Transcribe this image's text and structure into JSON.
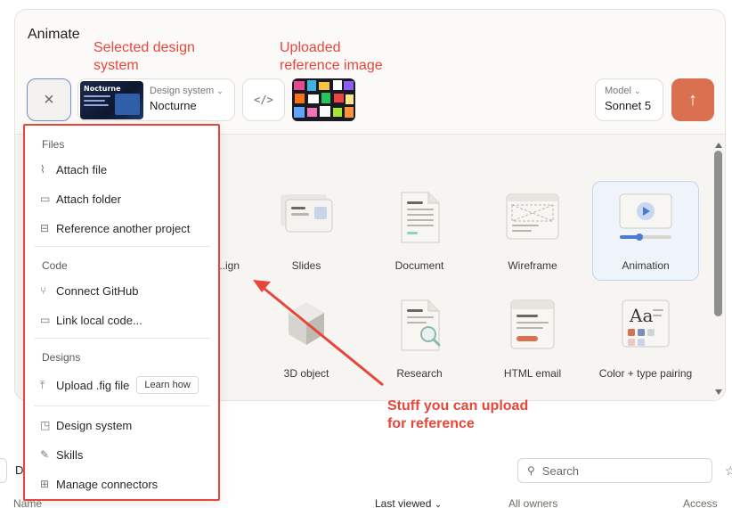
{
  "app": {
    "title": "Animate"
  },
  "toolbar": {
    "close_glyph": "×",
    "design_system": {
      "label": "Design system",
      "value": "Nocturne",
      "thumb_text": "Nocturne"
    },
    "code_glyph": "</>",
    "model": {
      "label": "Model",
      "value": "Sonnet 5"
    },
    "send_glyph": "↑"
  },
  "annotations": {
    "selected_design": "Selected design system",
    "uploaded_ref": "Uploaded reference image",
    "upload_hint": "Stuff you can upload for reference",
    "color": "#e8463b"
  },
  "templates": [
    {
      "label": "...ign"
    },
    {
      "label": "Slides"
    },
    {
      "label": "Document"
    },
    {
      "label": "Wireframe"
    },
    {
      "label": "Animation",
      "selected": true
    },
    {
      "label": "3D object"
    },
    {
      "label": "Research"
    },
    {
      "label": "HTML email"
    },
    {
      "label": "Color + type pairing"
    }
  ],
  "menu": {
    "sections": {
      "files": "Files",
      "code": "Code",
      "designs": "Designs"
    },
    "items": {
      "attach_file": "Attach file",
      "attach_folder": "Attach folder",
      "reference_project": "Reference another project",
      "connect_github": "Connect GitHub",
      "link_local_code": "Link local code...",
      "upload_fig": "Upload .fig file",
      "learn_how": "Learn how",
      "design_system": "Design system",
      "skills": "Skills",
      "manage_connectors": "Manage connectors"
    }
  },
  "page": {
    "search_placeholder": "Search",
    "d_fragment": "D",
    "columns": {
      "name": "Name",
      "last_viewed": "Last viewed",
      "owners": "All owners",
      "access": "Access"
    }
  },
  "colors": {
    "accent": "#d9704f",
    "annotation_red": "#e8463b",
    "selected_tile": "#eef4f9"
  }
}
